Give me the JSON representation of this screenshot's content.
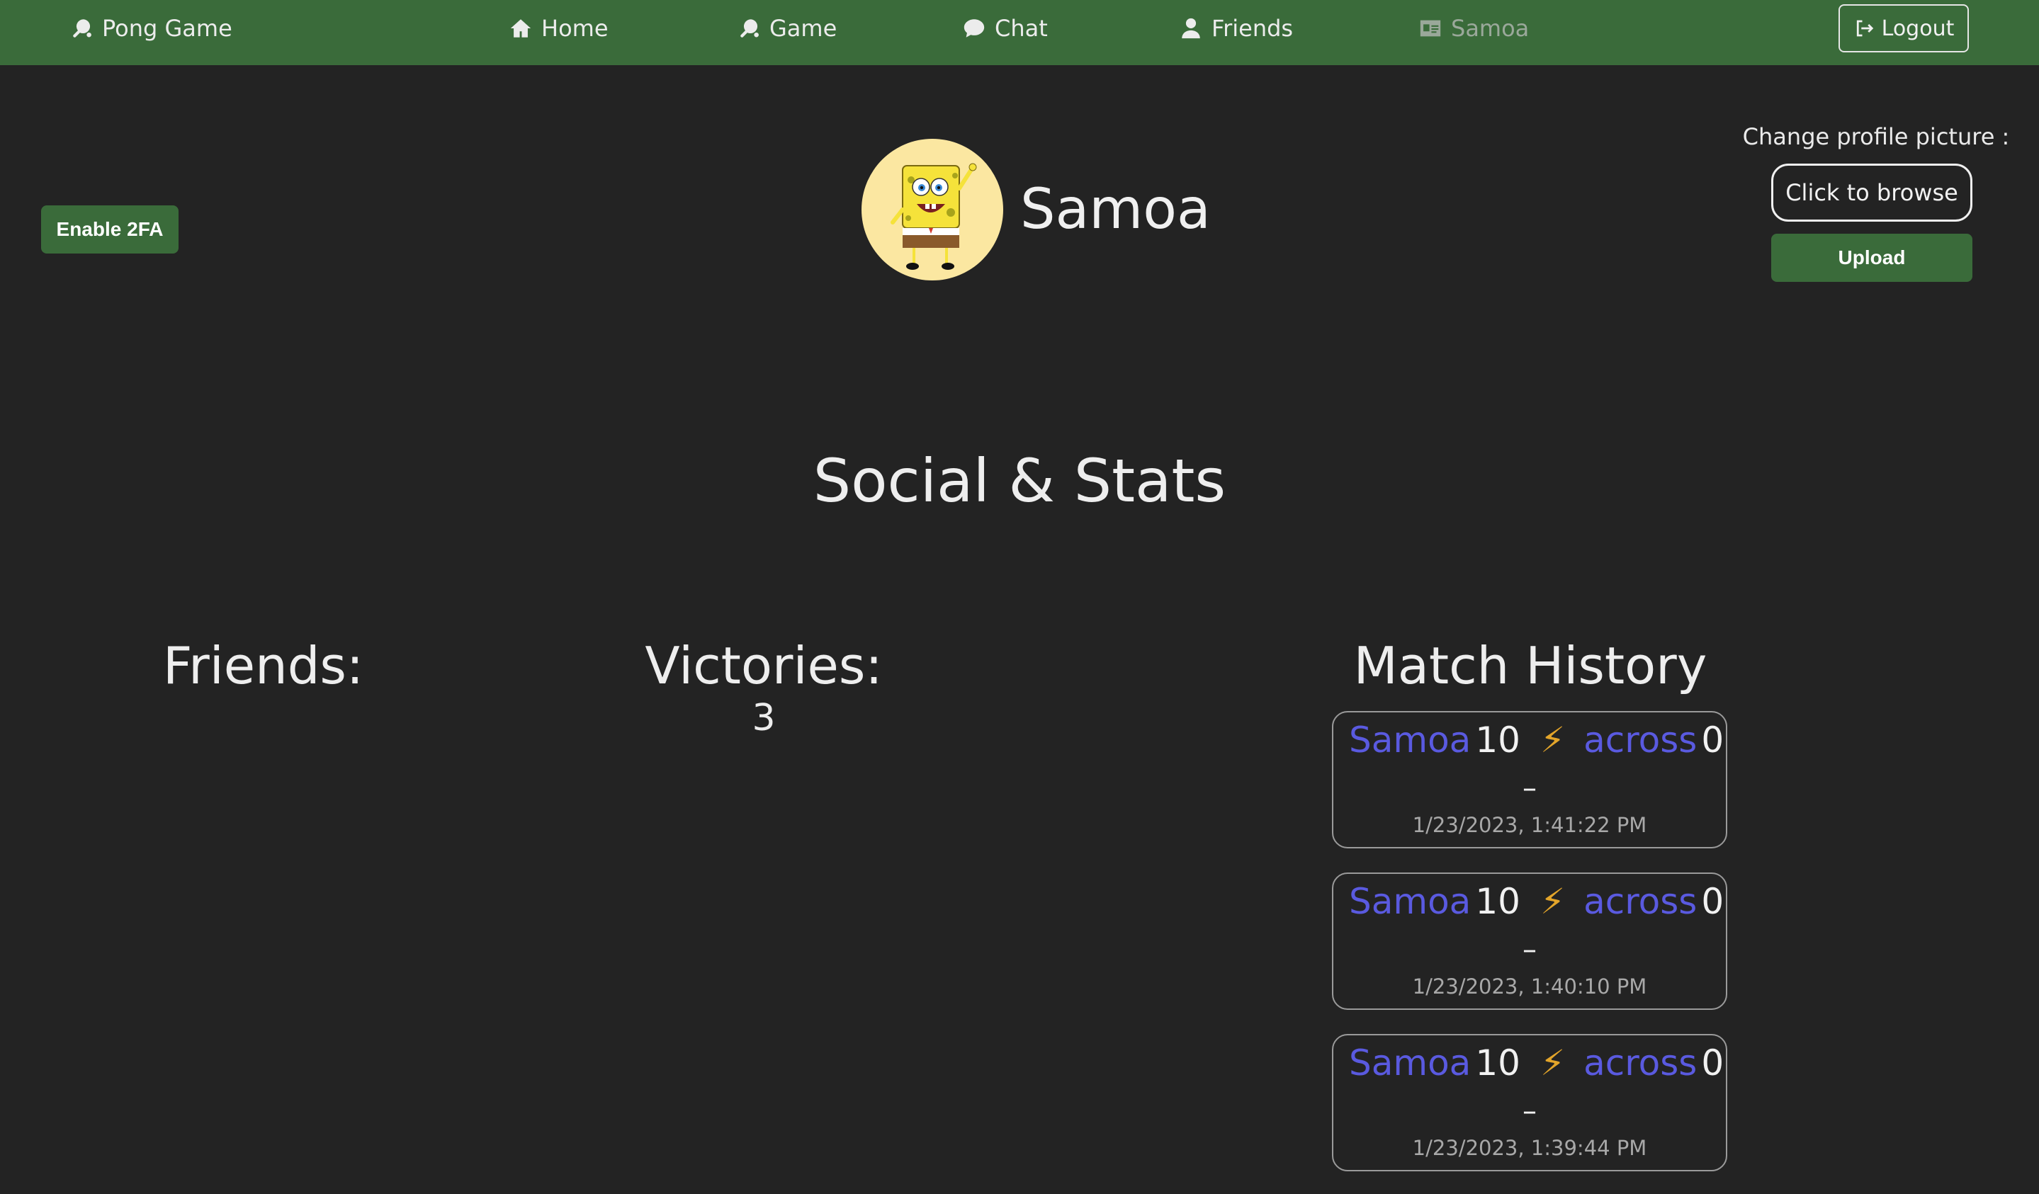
{
  "nav": {
    "brand": "Pong Game",
    "home": "Home",
    "game": "Game",
    "chat": "Chat",
    "friends": "Friends",
    "profile": "Samoa",
    "logout": "Logout"
  },
  "profile": {
    "enable_2fa": "Enable 2FA",
    "username": "Samoa",
    "change_picture_label": "Change profile picture :",
    "browse_label": "Click to browse",
    "upload_label": "Upload"
  },
  "stats": {
    "section_title": "Social & Stats",
    "friends_title": "Friends:",
    "victories_title": "Victories:",
    "victories_value": "3",
    "history_title": "Match History"
  },
  "matches": [
    {
      "player1": "Samoa",
      "score1": "10",
      "icon": "bolt-icon",
      "player2": "across",
      "score2": "0",
      "separator": "–",
      "date": "1/23/2023, 1:41:22 PM"
    },
    {
      "player1": "Samoa",
      "score1": "10",
      "icon": "bolt-icon",
      "player2": "across",
      "score2": "0",
      "separator": "–",
      "date": "1/23/2023, 1:40:10 PM"
    },
    {
      "player1": "Samoa",
      "score1": "10",
      "icon": "bolt-icon",
      "player2": "across",
      "score2": "0",
      "separator": "–",
      "date": "1/23/2023, 1:39:44 PM"
    }
  ],
  "colors": {
    "background": "#232323",
    "navbar": "#3a6b3a",
    "player_link": "#5a5ae0",
    "bolt": "#e3a52a",
    "avatar_bg": "#fbe7a1"
  }
}
